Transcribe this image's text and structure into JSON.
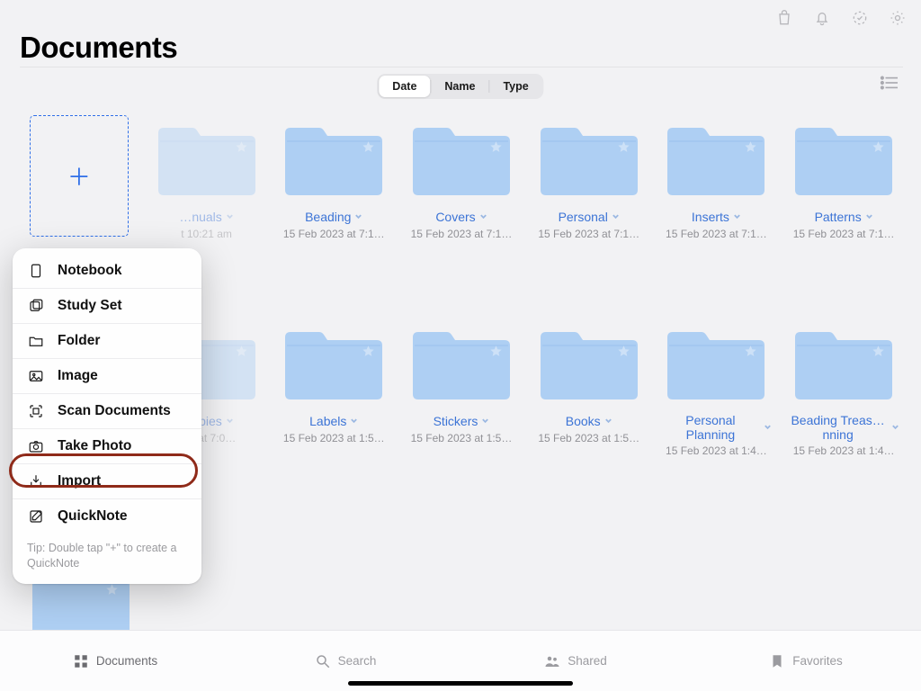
{
  "header": {
    "title": "Documents"
  },
  "sort": {
    "options": [
      "Date",
      "Name",
      "Type"
    ],
    "selected": "Date"
  },
  "new_menu": {
    "items": [
      {
        "icon": "notebook-icon",
        "label": "Notebook"
      },
      {
        "icon": "studyset-icon",
        "label": "Study Set"
      },
      {
        "icon": "folder-icon",
        "label": "Folder"
      },
      {
        "icon": "image-icon",
        "label": "Image"
      },
      {
        "icon": "scan-icon",
        "label": "Scan Documents"
      },
      {
        "icon": "camera-icon",
        "label": "Take Photo"
      },
      {
        "icon": "import-icon",
        "label": "Import"
      },
      {
        "icon": "quicknote-icon",
        "label": "QuickNote"
      }
    ],
    "tip": "Tip: Double tap \"+\" to create a QuickNote",
    "highlighted_index": 6
  },
  "folders_row1": [
    {
      "name": "…nuals",
      "date": "t 10:21 am"
    },
    {
      "name": "Beading",
      "date": "15 Feb 2023 at 7:1…"
    },
    {
      "name": "Covers",
      "date": "15 Feb 2023 at 7:1…"
    },
    {
      "name": "Personal",
      "date": "15 Feb 2023 at 7:1…"
    },
    {
      "name": "Inserts",
      "date": "15 Feb 2023 at 7:1…"
    },
    {
      "name": "Patterns",
      "date": "15 Feb 2023 at 7:1…"
    }
  ],
  "folders_row2": [
    {
      "name": "…ebies",
      "date": "023 at 7:0…"
    },
    {
      "name": "Labels",
      "date": "15 Feb 2023 at 1:5…"
    },
    {
      "name": "Stickers",
      "date": "15 Feb 2023 at 1:5…"
    },
    {
      "name": "Books",
      "date": "15 Feb 2023 at 1:5…"
    },
    {
      "name": "Personal Planning",
      "date": "15 Feb 2023 at 1:4…"
    },
    {
      "name": "Beading Treas…nning",
      "date": "15 Feb 2023 at 1:4…"
    }
  ],
  "bottom_tabs": [
    {
      "icon": "grid-icon",
      "label": "Documents",
      "active": true
    },
    {
      "icon": "search-icon",
      "label": "Search"
    },
    {
      "icon": "people-icon",
      "label": "Shared"
    },
    {
      "icon": "bookmark-icon",
      "label": "Favorites"
    }
  ]
}
